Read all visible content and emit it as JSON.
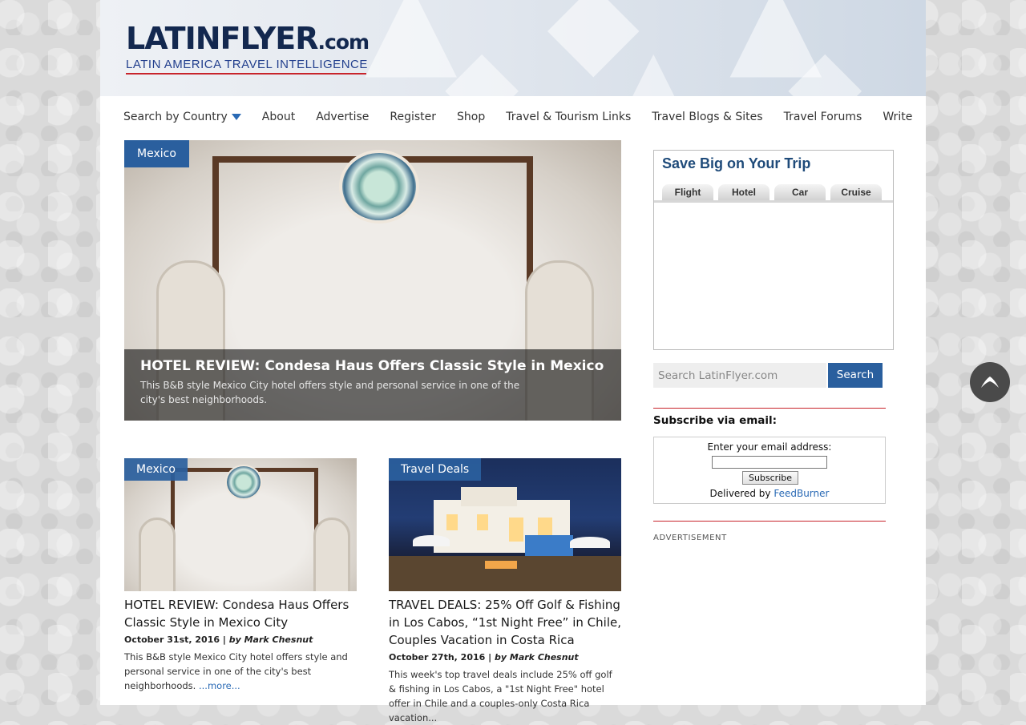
{
  "header": {
    "logo_main": "LATINFLYER",
    "logo_suffix": ".com",
    "logo_tagline": "LATIN AMERICA TRAVEL INTELLIGENCE"
  },
  "nav": {
    "search_by_country": "Search by Country",
    "about": "About",
    "advertise": "Advertise",
    "register": "Register",
    "shop": "Shop",
    "travel_tourism_links": "Travel & Tourism Links",
    "travel_blogs_sites": "Travel Blogs & Sites",
    "travel_forums": "Travel Forums",
    "write": "Write"
  },
  "hero": {
    "category": "Mexico",
    "title": "HOTEL REVIEW: Condesa Haus Offers Classic Style in Mexico ...",
    "subtitle": "This B&B style Mexico City hotel offers style and personal service in one of the city's best neighborhoods."
  },
  "articles": [
    {
      "category": "Mexico",
      "title": "HOTEL REVIEW: Condesa Haus Offers Classic Style in Mexico City",
      "date": "October 31st, 2016 |",
      "author": "by Mark Chesnut",
      "excerpt": "This B&B style Mexico City hotel offers style and personal service in one of the city's best neighborhoods.",
      "more": "...more..."
    },
    {
      "category": "Travel Deals",
      "title": "TRAVEL DEALS: 25% Off Golf & Fishing in Los Cabos, “1st Night Free” in Chile, Couples Vacation in Costa Rica",
      "date": "October 27th, 2016 |",
      "author": "by Mark Chesnut",
      "excerpt": "This week's top travel deals include 25% off golf & fishing in Los Cabos, a \"1st Night Free\" hotel offer in Chile and a couples-only Costa Rica vacation..."
    }
  ],
  "sidebar": {
    "widget_title": "Save Big on Your Trip",
    "widget_tabs": [
      "Flight",
      "Hotel",
      "Car",
      "Cruise"
    ],
    "search_placeholder": "Search LatinFlyer.com",
    "search_button": "Search",
    "subscribe_heading": "Subscribe via email:",
    "subscribe_label": "Enter your email address:",
    "subscribe_button": "Subscribe",
    "delivered_by": "Delivered by",
    "feedburner": "FeedBurner",
    "advertisement": "ADVERTISEMENT"
  },
  "icons": {
    "scroll_top": "arrow-up-icon",
    "dropdown": "caret-down-icon"
  },
  "colors": {
    "accent_blue": "#2a5f9e",
    "link_blue": "#2a6ab5",
    "rule_red": "#c8242b",
    "logo_navy": "#13284f"
  }
}
